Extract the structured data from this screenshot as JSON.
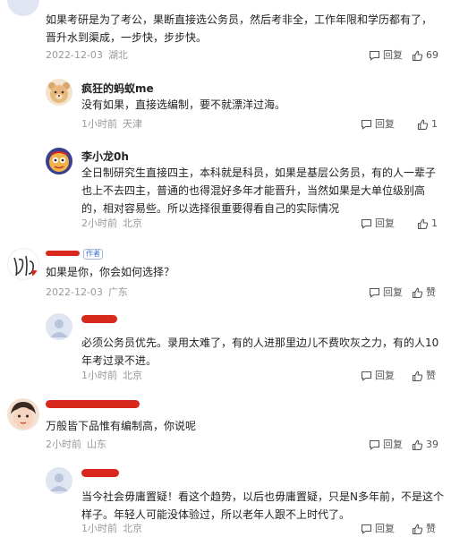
{
  "comments": [
    {
      "text": "如果考研是为了考公，果断直接选公务员，然后考非全，工作年限和学历都有了，晋升水到渠成，一步快，步步快。",
      "date": "2022-12-03",
      "location": "湖北",
      "reply_label": "回复",
      "like_count": "69"
    },
    {
      "name": "疯狂的蚂蚁me",
      "text": "没有如果，直接选编制，要不就漂洋过海。",
      "date": "1小时前",
      "location": "天津",
      "reply_label": "回复",
      "like_count": "1"
    },
    {
      "name": "李小龙0h",
      "text": "全日制研究生直接四主，本科就是科员，如果是基层公务员，有的人一辈子也上不去四主，普通的也得混好多年才能晋升，当然如果是大单位级别高的，相对容易些。所以选择很重要得看自己的实际情况",
      "date": "2小时前",
      "location": "北京",
      "reply_label": "回复",
      "like_count": "1"
    },
    {
      "tag": "作者",
      "text": "如果是你，你会如何选择？",
      "date": "2022-12-03",
      "location": "广东",
      "reply_label": "回复",
      "like_label": "赞"
    },
    {
      "text": "必须公务员优先。录用太难了，有的人进那里边儿不费吹灰之力，有的人10年考过录不进。",
      "date": "1小时前",
      "location": "北京",
      "reply_label": "回复",
      "like_label": "赞"
    },
    {
      "text": "万般皆下品惟有编制高，你说呢",
      "date": "2小时前",
      "location": "山东",
      "reply_label": "回复",
      "like_count": "39"
    },
    {
      "text": "当今社会毋庸置疑！看这个趋势，以后也毋庸置疑，只是N多年前，不是这个样子。年轻人可能没体验过，所以老年人跟不上时代了。",
      "date": "1小时前",
      "location": "北京",
      "reply_label": "回复",
      "like_label": "赞"
    }
  ],
  "icons": {
    "reply": "comment-bubble-icon",
    "like": "thumbs-up-icon"
  },
  "colors": {
    "redaction": "#d9281e",
    "meta_gray": "#999999",
    "author_tag_blue": "#3a6fd8"
  }
}
